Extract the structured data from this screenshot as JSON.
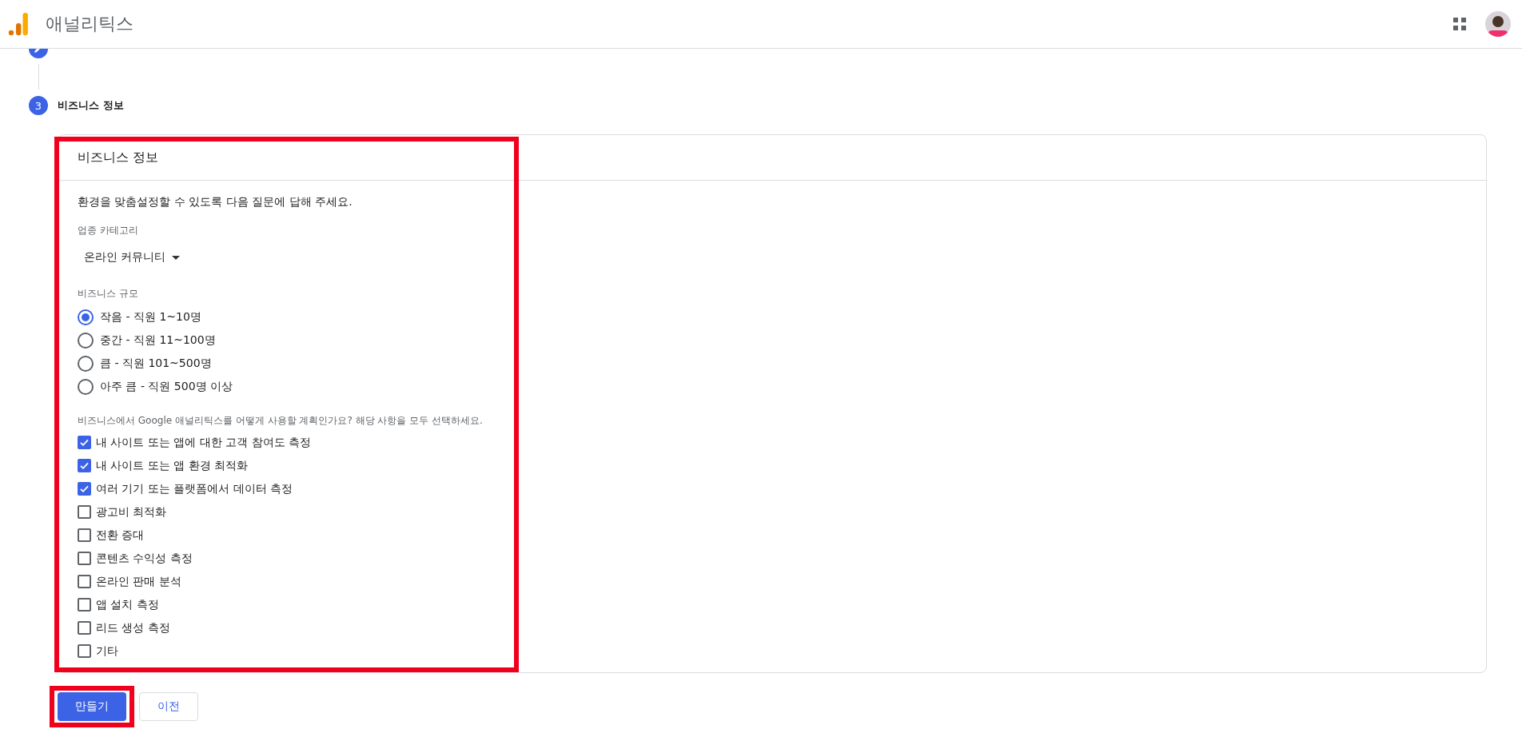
{
  "header": {
    "title": "애널리틱스"
  },
  "steps": [
    {
      "number": "3",
      "label": "비즈니스 정보"
    }
  ],
  "card": {
    "title": "비즈니스 정보",
    "highlighted": true,
    "intro": "환경을 맞춤설정할 수 있도록 다음 질문에 답해 주세요.",
    "category": {
      "label": "업종 카테고리",
      "value": "온라인 커뮤니티"
    },
    "size": {
      "label": "비즈니스 규모",
      "options": [
        {
          "label": "작음 - 직원 1~10명",
          "selected": true
        },
        {
          "label": "중간 - 직원 11~100명",
          "selected": false
        },
        {
          "label": "큼 - 직원 101~500명",
          "selected": false
        },
        {
          "label": "아주 큼 - 직원 500명 이상",
          "selected": false
        }
      ]
    },
    "usage": {
      "label": "비즈니스에서 Google 애널리틱스를 어떻게 사용할 계획인가요? 해당 사항을 모두 선택하세요.",
      "options": [
        {
          "label": "내 사이트 또는 앱에 대한 고객 참여도 측정",
          "checked": true
        },
        {
          "label": "내 사이트 또는 앱 환경 최적화",
          "checked": true
        },
        {
          "label": "여러 기기 또는 플랫폼에서 데이터 측정",
          "checked": true
        },
        {
          "label": "광고비 최적화",
          "checked": false
        },
        {
          "label": "전환 증대",
          "checked": false
        },
        {
          "label": "콘텐츠 수익성 측정",
          "checked": false
        },
        {
          "label": "온라인 판매 분석",
          "checked": false
        },
        {
          "label": "앱 설치 측정",
          "checked": false
        },
        {
          "label": "리드 생성 측정",
          "checked": false
        },
        {
          "label": "기타",
          "checked": false
        }
      ]
    }
  },
  "buttons": [
    {
      "label": "만들기",
      "kind": "primary",
      "highlighted": true
    },
    {
      "label": "이전",
      "kind": "secondary"
    }
  ]
}
